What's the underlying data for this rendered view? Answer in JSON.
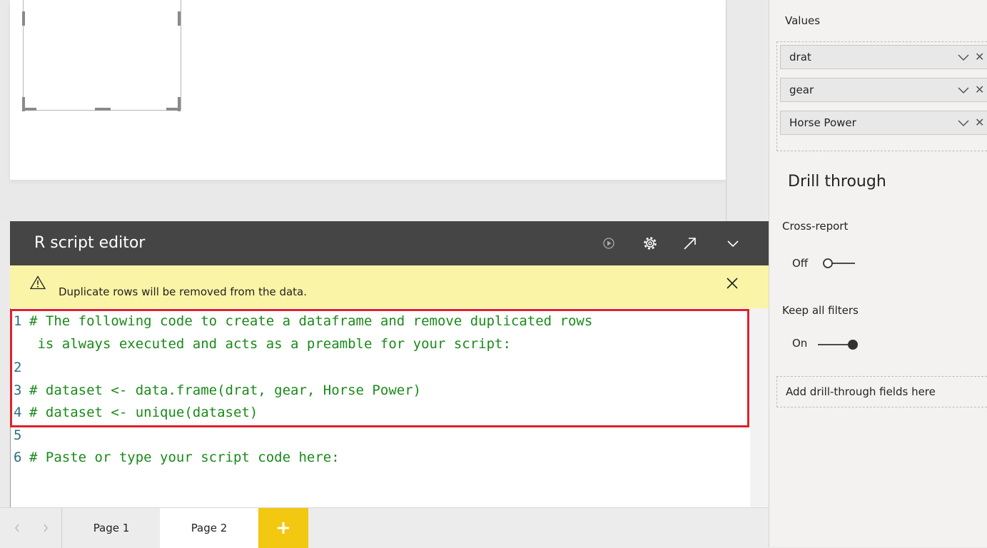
{
  "fields_pane": {
    "values_title": "Values",
    "fields": [
      "drat",
      "gear",
      "Horse Power"
    ],
    "drill_through_title": "Drill through",
    "cross_report_label": "Cross-report",
    "cross_report_state": "Off",
    "keep_filters_label": "Keep all filters",
    "keep_filters_state": "On",
    "drill_fields_placeholder": "Add drill-through fields here"
  },
  "editor": {
    "title": "R script editor",
    "warning": "Duplicate rows will be removed from the data.",
    "lines": [
      {
        "num": "1",
        "text": "# The following code to create a dataframe and remove duplicated rows"
      },
      {
        "num": "",
        "text": " is always executed and acts as a preamble for your script:"
      },
      {
        "num": "2",
        "text": ""
      },
      {
        "num": "3",
        "text": "# dataset <- data.frame(drat, gear, Horse Power)"
      },
      {
        "num": "4",
        "text": "# dataset <- unique(dataset)"
      },
      {
        "num": "5",
        "text": ""
      },
      {
        "num": "6",
        "text": "# Paste or type your script code here:"
      }
    ]
  },
  "tabs": {
    "page1": "Page 1",
    "page2": "Page 2",
    "add": "+"
  },
  "colors": {
    "highlight": "#e0202a",
    "code_comment": "#1a8a1a",
    "line_number": "#2b6f7d",
    "warning_bg": "#faf4a6",
    "add_tab": "#f2c811"
  }
}
